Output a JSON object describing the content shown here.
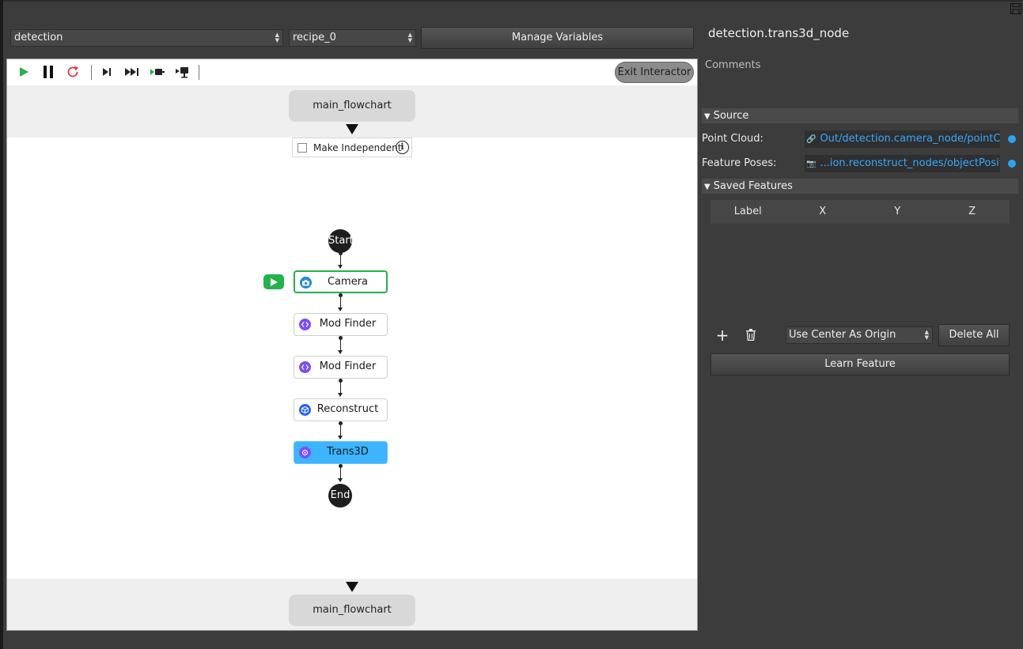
{
  "header": {
    "workspace_select": "detection",
    "recipe_select": "recipe_0",
    "manage_variables_label": "Manage Variables"
  },
  "canvas": {
    "toolbar": {
      "icons": [
        "play-icon",
        "pause-icon",
        "restart-icon",
        "step-icon",
        "fast-forward-icon",
        "step-into-icon",
        "run-to-node-icon"
      ],
      "exit_interactor_label": "Exit Interactor"
    },
    "parent_flowchart_top": "main_flowchart",
    "parent_flowchart_bottom": "main_flowchart",
    "make_independent_label": "Make Independent",
    "info_glyph": "i",
    "start_label": "Start",
    "end_label": "End",
    "nodes": [
      {
        "label": "Camera",
        "icon": "camera-icon",
        "icon_color": "#1e88e5",
        "state": "active"
      },
      {
        "label": "Mod Finder",
        "icon": "code-icon",
        "icon_color": "#7c4dff",
        "state": "normal"
      },
      {
        "label": "Mod Finder",
        "icon": "code-icon",
        "icon_color": "#7c4dff",
        "state": "normal"
      },
      {
        "label": "Reconstruct",
        "icon": "cube-icon",
        "icon_color": "#2962ff",
        "state": "normal"
      },
      {
        "label": "Trans3D",
        "icon": "transform-icon",
        "icon_color": "#7c4dff",
        "state": "selected"
      }
    ],
    "colors": {
      "active_border": "#22b34a",
      "selected_fill": "#3cb4ff"
    }
  },
  "panel": {
    "node_title": "detection.trans3d_node",
    "comments_label": "Comments",
    "source": {
      "header": "Source",
      "point_cloud_label": "Point Cloud:",
      "point_cloud_value": "Out/detection.camera_node/pointCloud",
      "feature_poses_label": "Feature Poses:",
      "feature_poses_value": "...ion.reconstruct_nodes/objectPositions"
    },
    "saved_features": {
      "header": "Saved Features",
      "columns": [
        "Label",
        "X",
        "Y",
        "Z"
      ],
      "rows": [],
      "add_glyph": "+",
      "origin_select": "Use Center As Origin",
      "delete_all_label": "Delete All",
      "learn_feature_label": "Learn Feature"
    },
    "link_color": "#35a9ff"
  }
}
